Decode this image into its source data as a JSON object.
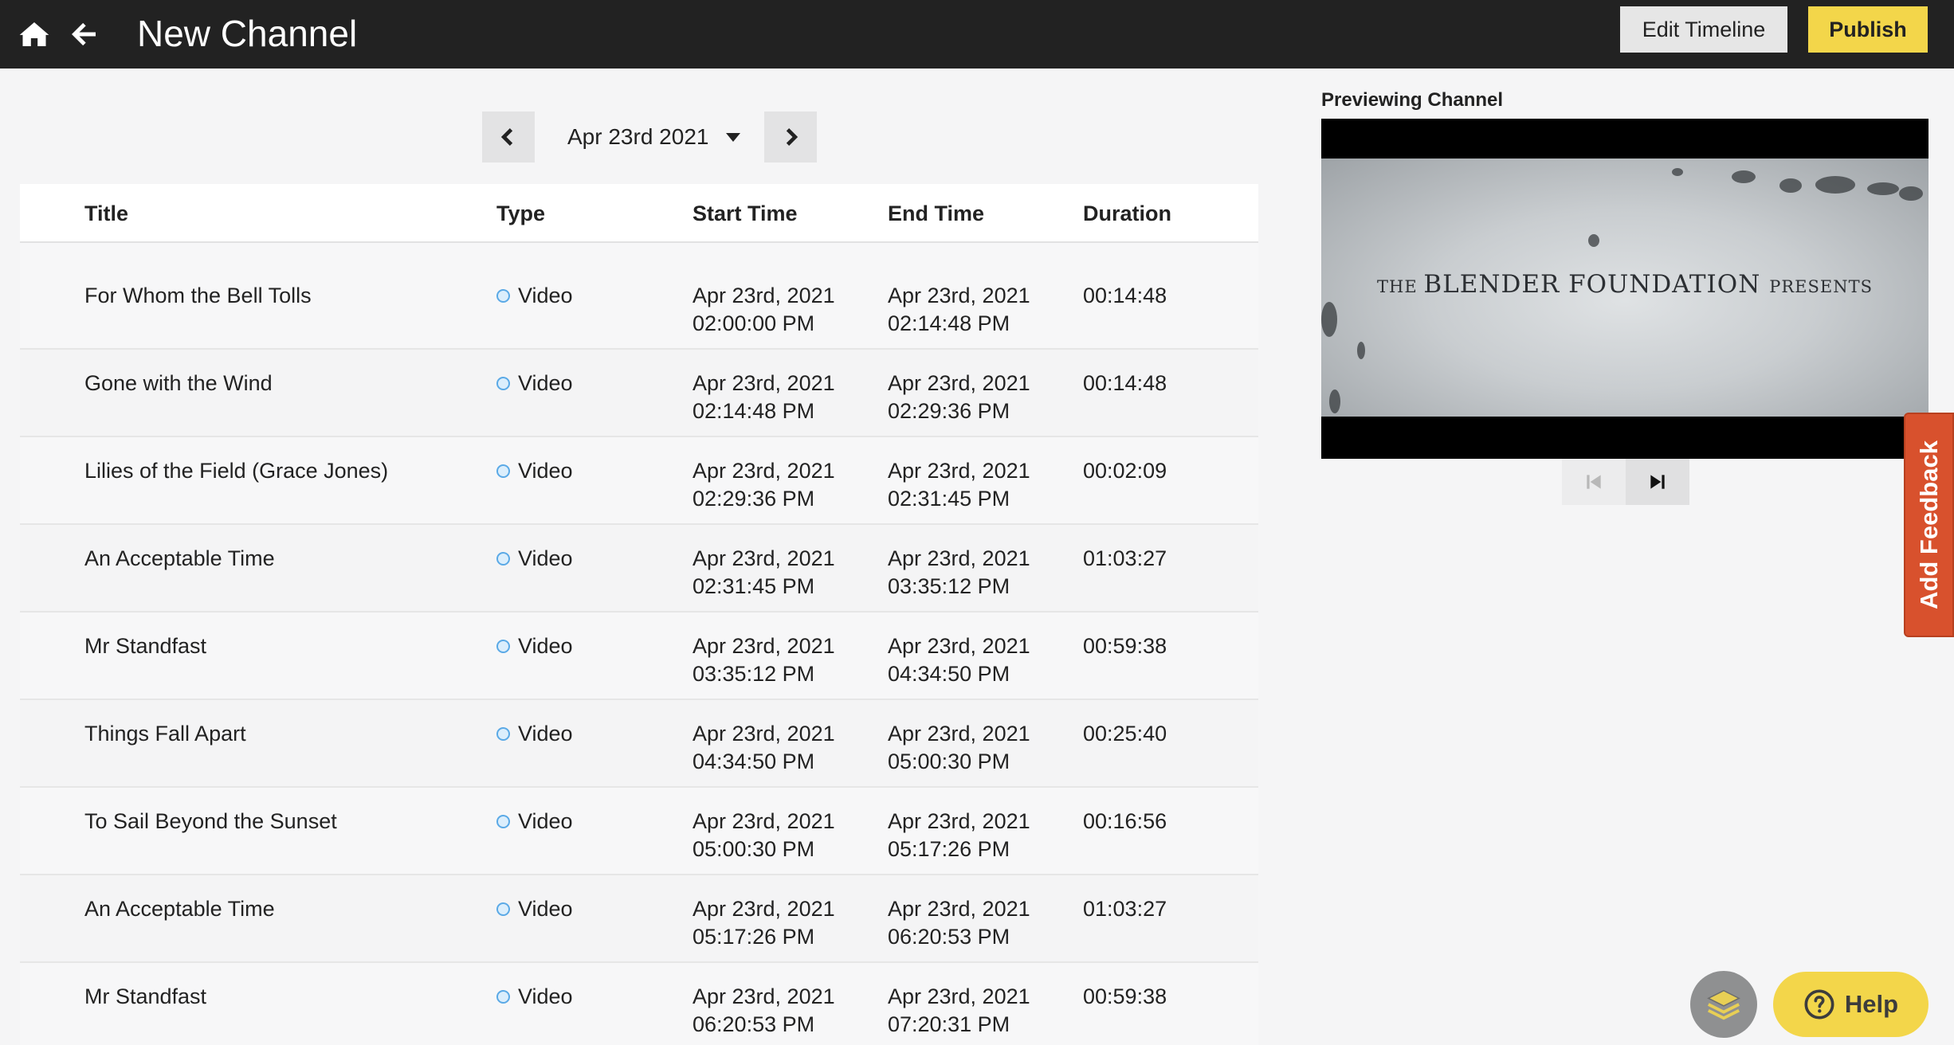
{
  "header": {
    "title": "New Channel",
    "edit_timeline_label": "Edit Timeline",
    "publish_label": "Publish"
  },
  "date_nav": {
    "selected_date": "Apr 23rd 2021"
  },
  "table": {
    "columns": [
      "Title",
      "Type",
      "Start Time",
      "End Time",
      "Duration"
    ],
    "rows": [
      {
        "title": "For Whom the Bell Tolls",
        "type": "Video",
        "start_date": "Apr 23rd, 2021",
        "start_time": "02:00:00 PM",
        "end_date": "Apr 23rd, 2021",
        "end_time": "02:14:48 PM",
        "duration": "00:14:48"
      },
      {
        "title": "Gone with the Wind",
        "type": "Video",
        "start_date": "Apr 23rd, 2021",
        "start_time": "02:14:48 PM",
        "end_date": "Apr 23rd, 2021",
        "end_time": "02:29:36 PM",
        "duration": "00:14:48"
      },
      {
        "title": "Lilies of the Field (Grace Jones)",
        "type": "Video",
        "start_date": "Apr 23rd, 2021",
        "start_time": "02:29:36 PM",
        "end_date": "Apr 23rd, 2021",
        "end_time": "02:31:45 PM",
        "duration": "00:02:09"
      },
      {
        "title": "An Acceptable Time",
        "type": "Video",
        "start_date": "Apr 23rd, 2021",
        "start_time": "02:31:45 PM",
        "end_date": "Apr 23rd, 2021",
        "end_time": "03:35:12 PM",
        "duration": "01:03:27"
      },
      {
        "title": "Mr Standfast",
        "type": "Video",
        "start_date": "Apr 23rd, 2021",
        "start_time": "03:35:12 PM",
        "end_date": "Apr 23rd, 2021",
        "end_time": "04:34:50 PM",
        "duration": "00:59:38"
      },
      {
        "title": "Things Fall Apart",
        "type": "Video",
        "start_date": "Apr 23rd, 2021",
        "start_time": "04:34:50 PM",
        "end_date": "Apr 23rd, 2021",
        "end_time": "05:00:30 PM",
        "duration": "00:25:40"
      },
      {
        "title": "To Sail Beyond the Sunset",
        "type": "Video",
        "start_date": "Apr 23rd, 2021",
        "start_time": "05:00:30 PM",
        "end_date": "Apr 23rd, 2021",
        "end_time": "05:17:26 PM",
        "duration": "00:16:56"
      },
      {
        "title": "An Acceptable Time",
        "type": "Video",
        "start_date": "Apr 23rd, 2021",
        "start_time": "05:17:26 PM",
        "end_date": "Apr 23rd, 2021",
        "end_time": "06:20:53 PM",
        "duration": "01:03:27"
      },
      {
        "title": "Mr Standfast",
        "type": "Video",
        "start_date": "Apr 23rd, 2021",
        "start_time": "06:20:53 PM",
        "end_date": "Apr 23rd, 2021",
        "end_time": "07:20:31 PM",
        "duration": "00:59:38"
      }
    ]
  },
  "preview": {
    "label": "Previewing Channel",
    "frame_text_the": "THE ",
    "frame_text_blender": "BLENDER ",
    "frame_text_foundation": "FOUNDATION ",
    "frame_text_presents": "PRESENTS"
  },
  "feedback": {
    "label": "Add Feedback",
    "color": "#d8512d"
  },
  "help": {
    "label": "Help",
    "color": "#f3d64a"
  },
  "colors": {
    "header_bg": "#222222",
    "publish_bg": "#f3d64a",
    "type_dot": "#5aa9e6"
  }
}
